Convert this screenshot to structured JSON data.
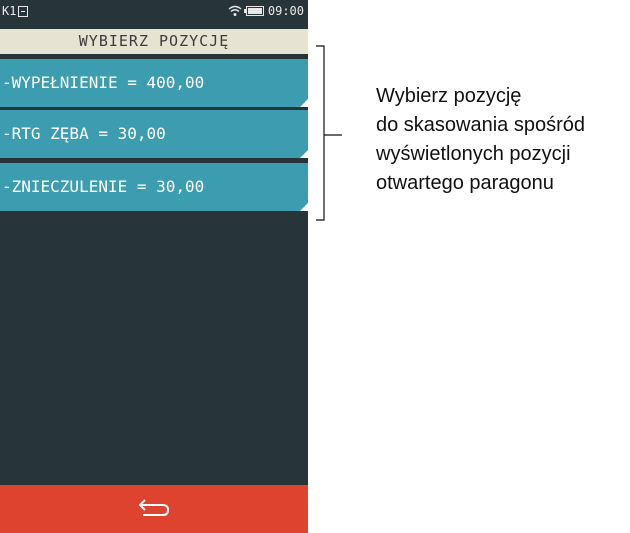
{
  "status": {
    "left_label": "K1",
    "time": "09:00"
  },
  "title": "WYBIERZ POZYCJĘ",
  "items": [
    {
      "label": "-WYPEŁNIENIE = 400,00"
    },
    {
      "label": "-RTG ZĘBA = 30,00"
    },
    {
      "label": "-ZNIECZULENIE = 30,00"
    }
  ],
  "bottom": {
    "icon": "back-arrow-icon"
  },
  "annotation": {
    "lines": [
      "Wybierz pozycję",
      "do skasowania spośród",
      "wyświetlonych pozycji",
      "otwartego paragonu"
    ]
  },
  "colors": {
    "screen_bg": "#283538",
    "title_bg": "#e6e3d2",
    "item_bg": "#3d9db0",
    "bottom_bar": "#de4330"
  }
}
